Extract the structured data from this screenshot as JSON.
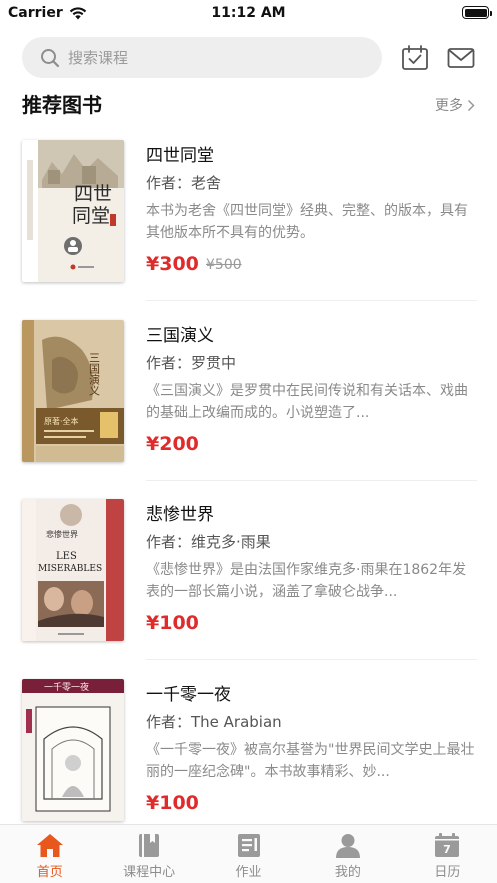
{
  "status_bar": {
    "carrier": "Carrier",
    "time": "11:12 AM"
  },
  "search": {
    "placeholder": "搜索课程"
  },
  "header_icons": [
    "calendar-check-icon",
    "mail-icon"
  ],
  "section": {
    "title": "推荐图书",
    "more_label": "更多"
  },
  "books": [
    {
      "title": "四世同堂",
      "author": "作者：老舍",
      "desc": "本书为老舍《四世同堂》经典、完整、的版本，具有其他版本所不具有的优势。",
      "price": "¥300",
      "old_price": "¥500"
    },
    {
      "title": "三国演义",
      "author": "作者：罗贯中",
      "desc": "《三国演义》是罗贯中在民间传说和有关话本、戏曲的基础上改编而成的。小说塑造了...",
      "price": "¥200"
    },
    {
      "title": "悲惨世界",
      "author": "作者：维克多·雨果",
      "desc": "《悲惨世界》是由法国作家维克多·雨果在1862年发表的一部长篇小说，涵盖了拿破仑战争...",
      "price": "¥100"
    },
    {
      "title": "一千零一夜",
      "author": "作者：The Arabian",
      "desc": "《一千零一夜》被高尔基誉为\"世界民间文学史上最壮丽的一座纪念碑\"。本书故事精彩、妙...",
      "price": "¥100"
    }
  ],
  "covers": {
    "b1": {
      "big1": "四世",
      "big2": "同堂"
    },
    "b2": {
      "big": "三国演义",
      "small": "原著·全本"
    },
    "b3": {
      "line1": "悲惨世界",
      "line2": "LES",
      "line3": "MISERABLES"
    },
    "b4": {
      "big": "一千零一夜"
    }
  },
  "tabs": [
    {
      "label": "首页",
      "icon": "home-icon",
      "active": true
    },
    {
      "label": "课程中心",
      "icon": "book-icon"
    },
    {
      "label": "作业",
      "icon": "homework-icon"
    },
    {
      "label": "我的",
      "icon": "profile-icon"
    },
    {
      "label": "日历",
      "icon": "calendar-icon",
      "day": "7"
    }
  ],
  "colors": {
    "accent": "#e8581e",
    "price": "#e02b2b",
    "tab_inactive": "#9a9a9a"
  }
}
